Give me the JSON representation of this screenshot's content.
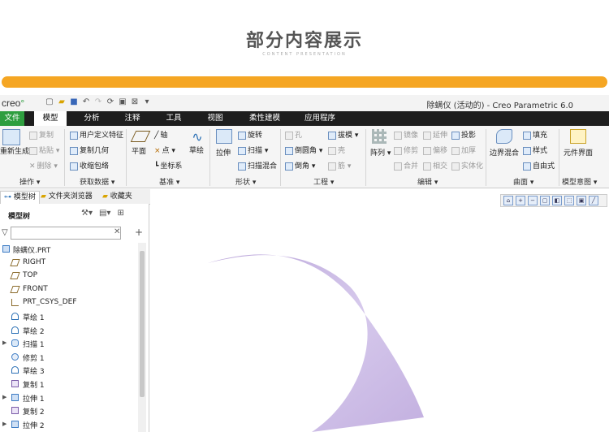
{
  "header": {
    "title": "部分内容展示",
    "subtitle": "CONTENT PRESENTATION"
  },
  "app": {
    "logo": "creo",
    "window_title": "除螨仪 (活动的) - Creo Parametric 6.0",
    "tabs": [
      {
        "label": "文件"
      },
      {
        "label": "模型"
      },
      {
        "label": "分析"
      },
      {
        "label": "注释"
      },
      {
        "label": "工具"
      },
      {
        "label": "视图"
      },
      {
        "label": "柔性建模"
      },
      {
        "label": "应用程序"
      }
    ],
    "ribbon": {
      "ops": {
        "regen": "重新生成",
        "copy": "复制",
        "paste": "粘贴",
        "delete": "删除",
        "group": "操作"
      },
      "data": {
        "udf": "用户定义特征",
        "copy_geom": "复制几何",
        "shrinkwrap": "收缩包络",
        "group": "获取数据"
      },
      "datum": {
        "axis": "轴",
        "plane": "平面",
        "point": "点",
        "csys": "坐标系",
        "sketch": "草绘",
        "group": "基准"
      },
      "shapes": {
        "extrude": "拉伸",
        "revolve": "旋转",
        "sweep": "扫描",
        "swept_blend": "扫描混合",
        "group": "形状"
      },
      "eng": {
        "hole": "孔",
        "round": "倒圆角",
        "chamfer": "倒角",
        "draft": "拔模",
        "shell": "壳",
        "rib": "筋",
        "group": "工程"
      },
      "edit": {
        "pattern": "阵列",
        "mirror": "镜像",
        "extend": "延伸",
        "project": "投影",
        "trim": "修剪",
        "offset": "偏移",
        "thicken": "加厚",
        "merge": "合并",
        "intersect": "相交",
        "solidify": "实体化",
        "group": "编辑"
      },
      "surf": {
        "boundary": "边界混合",
        "fill": "填充",
        "style": "样式",
        "freestyle": "自由式",
        "group": "曲面"
      },
      "intent": {
        "component_ui": "元件界面",
        "group": "模型意图"
      }
    },
    "left_tabs": [
      "模型树",
      "文件夹浏览器",
      "收藏夹"
    ],
    "tree_header": "模型树",
    "tree": [
      {
        "label": "除螨仪.PRT",
        "icon": "part-icon",
        "expand": ""
      },
      {
        "label": "RIGHT",
        "icon": "plane-icon",
        "expand": ""
      },
      {
        "label": "TOP",
        "icon": "plane-icon",
        "expand": ""
      },
      {
        "label": "FRONT",
        "icon": "plane-icon",
        "expand": ""
      },
      {
        "label": "PRT_CSYS_DEF",
        "icon": "csys-icon",
        "expand": ""
      },
      {
        "label": "草绘 1",
        "icon": "sketch-icon",
        "expand": ""
      },
      {
        "label": "草绘 2",
        "icon": "sketch-icon",
        "expand": ""
      },
      {
        "label": "扫描 1",
        "icon": "sweep-icon",
        "expand": "▶"
      },
      {
        "label": "修剪 1",
        "icon": "trim-icon",
        "expand": ""
      },
      {
        "label": "草绘 3",
        "icon": "sketch-icon",
        "expand": ""
      },
      {
        "label": "复制 1",
        "icon": "copy-icon",
        "expand": ""
      },
      {
        "label": "拉伸 1",
        "icon": "extrude-icon",
        "expand": "▶"
      },
      {
        "label": "复制 2",
        "icon": "copy-icon",
        "expand": ""
      },
      {
        "label": "拉伸 2",
        "icon": "extrude-icon",
        "expand": "▶"
      }
    ]
  },
  "colors": {
    "accent_bar": "#f5a623",
    "file_tab": "#2e9e3f",
    "surface": "#c9b6e2"
  }
}
